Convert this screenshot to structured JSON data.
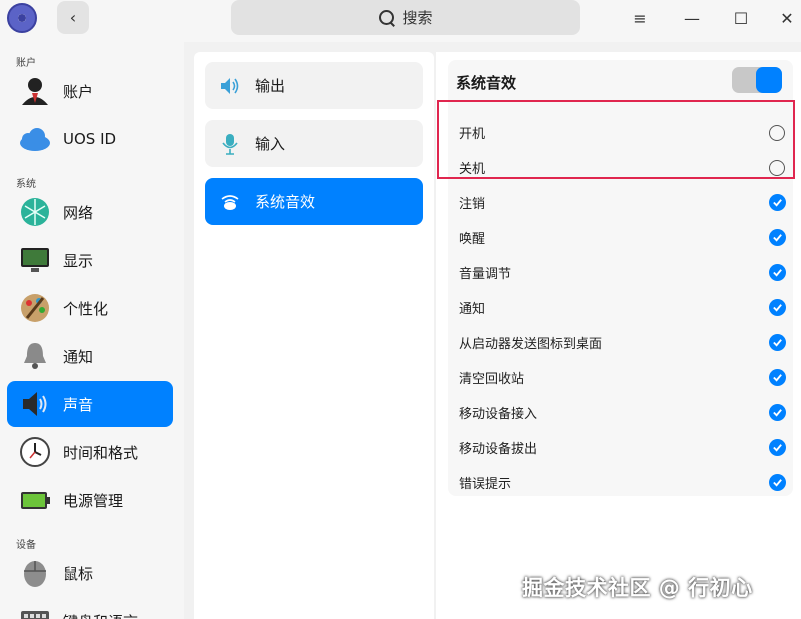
{
  "titlebar": {
    "search_label": "搜索",
    "back_icon": "‹",
    "menu_icon": "≡",
    "minimize_icon": "—",
    "maximize_icon": "☐",
    "close_icon": "✕"
  },
  "sidebar": {
    "groups": {
      "account": "账户",
      "system": "系统",
      "device": "设备"
    },
    "items": [
      {
        "label": "账户",
        "icon": "user-icon"
      },
      {
        "label": "UOS ID",
        "icon": "cloud-icon"
      },
      {
        "label": "网络",
        "icon": "network-icon"
      },
      {
        "label": "显示",
        "icon": "monitor-icon"
      },
      {
        "label": "个性化",
        "icon": "palette-icon"
      },
      {
        "label": "通知",
        "icon": "bell-icon"
      },
      {
        "label": "声音",
        "icon": "speaker-icon",
        "active": true
      },
      {
        "label": "时间和格式",
        "icon": "clock-icon"
      },
      {
        "label": "电源管理",
        "icon": "battery-icon"
      },
      {
        "label": "鼠标",
        "icon": "mouse-icon"
      },
      {
        "label": "键盘和语言",
        "icon": "keyboard-icon"
      }
    ]
  },
  "sound_nav": {
    "items": [
      {
        "label": "输出",
        "icon": "speaker-output-icon"
      },
      {
        "label": "输入",
        "icon": "microphone-icon"
      },
      {
        "label": "系统音效",
        "icon": "sound-effects-icon",
        "active": true
      }
    ]
  },
  "effects": {
    "title": "系统音效",
    "enabled": true,
    "items": [
      {
        "label": "开机",
        "checked": false
      },
      {
        "label": "关机",
        "checked": false
      },
      {
        "label": "注销",
        "checked": true
      },
      {
        "label": "唤醒",
        "checked": true
      },
      {
        "label": "音量调节",
        "checked": true
      },
      {
        "label": "通知",
        "checked": true
      },
      {
        "label": "从启动器发送图标到桌面",
        "checked": true
      },
      {
        "label": "清空回收站",
        "checked": true
      },
      {
        "label": "移动设备接入",
        "checked": true
      },
      {
        "label": "移动设备拔出",
        "checked": true
      },
      {
        "label": "错误提示",
        "checked": true
      }
    ]
  },
  "watermark": "掘金技术社区 @ 行初心",
  "colors": {
    "accent": "#0081ff",
    "highlight_border": "#e0264f"
  }
}
